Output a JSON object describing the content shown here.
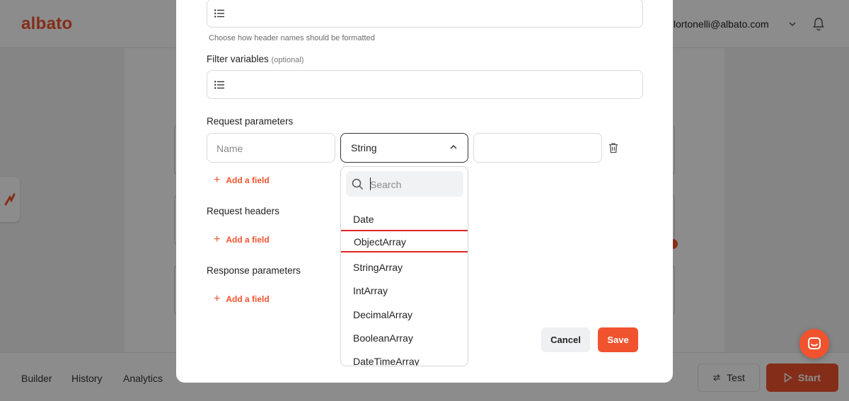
{
  "app": {
    "logo": "albato",
    "user_email": ".lortonelli@albato.com",
    "tabs": [
      "Builder",
      "History",
      "Analytics"
    ],
    "test_label": "Test",
    "start_label": "Start"
  },
  "modal": {
    "header_format_hint": "Choose how header names should be formatted",
    "filter_variables_label": "Filter variables",
    "filter_variables_optional": "(optional)",
    "request_parameters_label": "Request parameters",
    "name_placeholder": "Name",
    "type_value": "String",
    "add_field_label": "Add a field",
    "request_headers_label": "Request headers",
    "response_parameters_label": "Response parameters",
    "cancel_label": "Cancel",
    "save_label": "Save"
  },
  "dropdown": {
    "search_placeholder": "Search",
    "options": [
      "Date",
      "ObjectArray",
      "StringArray",
      "IntArray",
      "DecimalArray",
      "BooleanArray",
      "DateTimeArray"
    ],
    "highlighted_option": "ObjectArray"
  },
  "colors": {
    "accent": "#f0532e",
    "highlight_border": "#e02424",
    "overlay": "rgba(0,0,0,0.45)"
  }
}
